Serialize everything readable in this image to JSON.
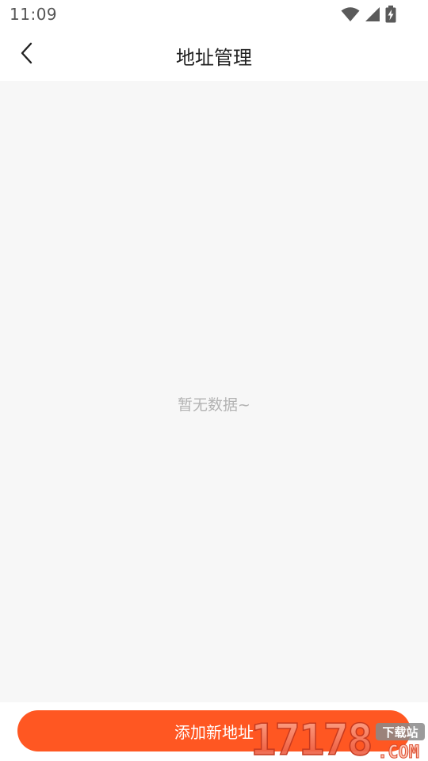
{
  "status_bar": {
    "time": "11:09",
    "icons": [
      "wifi-icon",
      "cellular-signal-icon",
      "battery-charging-icon"
    ]
  },
  "header": {
    "back_icon": "chevron-left-icon",
    "title": "地址管理"
  },
  "content": {
    "empty_text": "暂无数据~"
  },
  "footer": {
    "add_button_label": "添加新地址"
  },
  "watermark": {
    "brand": "17178",
    "suffix": ".COM",
    "tag": "下载站"
  },
  "colors": {
    "accent": "#ff5722",
    "background": "#f7f7f7",
    "empty_text": "#b3b3b3",
    "title_text": "#222222"
  }
}
